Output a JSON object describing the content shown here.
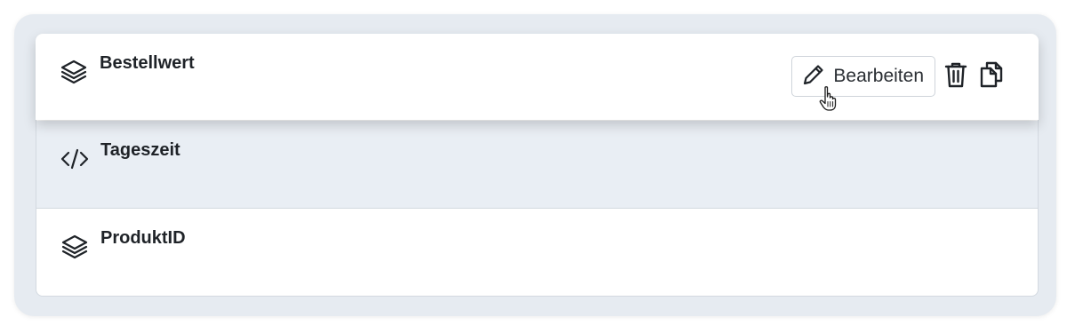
{
  "rows": [
    {
      "label": "Bestellwert",
      "icon": "layers-icon",
      "hovered": true
    },
    {
      "label": "Tageszeit",
      "icon": "code-icon",
      "selected": true
    },
    {
      "label": "ProduktID",
      "icon": "layers-icon"
    }
  ],
  "actions": {
    "edit_label": "Bearbeiten",
    "edit_icon": "pencil-icon",
    "delete_icon": "trash-icon",
    "copy_icon": "copy-icon"
  },
  "colors": {
    "panel_background": "#e6ebf1",
    "selected_row": "#e9eef4",
    "text": "#1f2328"
  }
}
